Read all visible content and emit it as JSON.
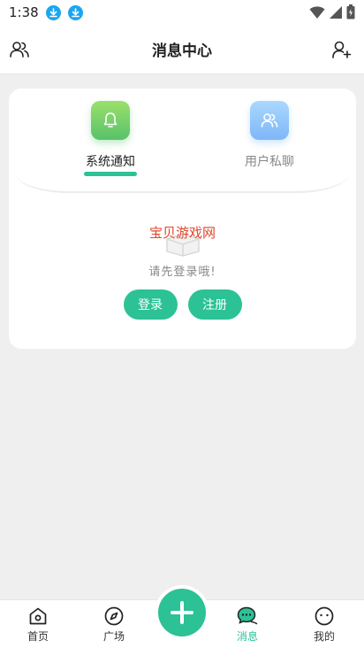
{
  "status_bar": {
    "time": "1:38",
    "icons": [
      "download-icon",
      "download-icon",
      "wifi-icon",
      "signal-icon",
      "battery-icon"
    ]
  },
  "header": {
    "title": "消息中心",
    "left_icon": "friends-icon",
    "right_icon": "add-user-icon"
  },
  "tabs": [
    {
      "label": "系统通知",
      "icon": "bell-icon",
      "active": true
    },
    {
      "label": "用户私聊",
      "icon": "users-icon",
      "active": false
    }
  ],
  "empty_state": {
    "watermark": "宝贝游戏网",
    "prompt": "请先登录哦!"
  },
  "buttons": {
    "login": "登录",
    "register": "注册"
  },
  "bottom_nav": {
    "items": [
      {
        "label": "首页",
        "icon": "home-icon"
      },
      {
        "label": "广场",
        "icon": "compass-icon"
      },
      {
        "label": "消息",
        "icon": "chat-icon",
        "active": true
      },
      {
        "label": "我的",
        "icon": "profile-icon"
      }
    ],
    "center_action": "plus-icon"
  },
  "colors": {
    "accent": "#2cc295",
    "background": "#efefef",
    "watermark": "#e0452a"
  }
}
